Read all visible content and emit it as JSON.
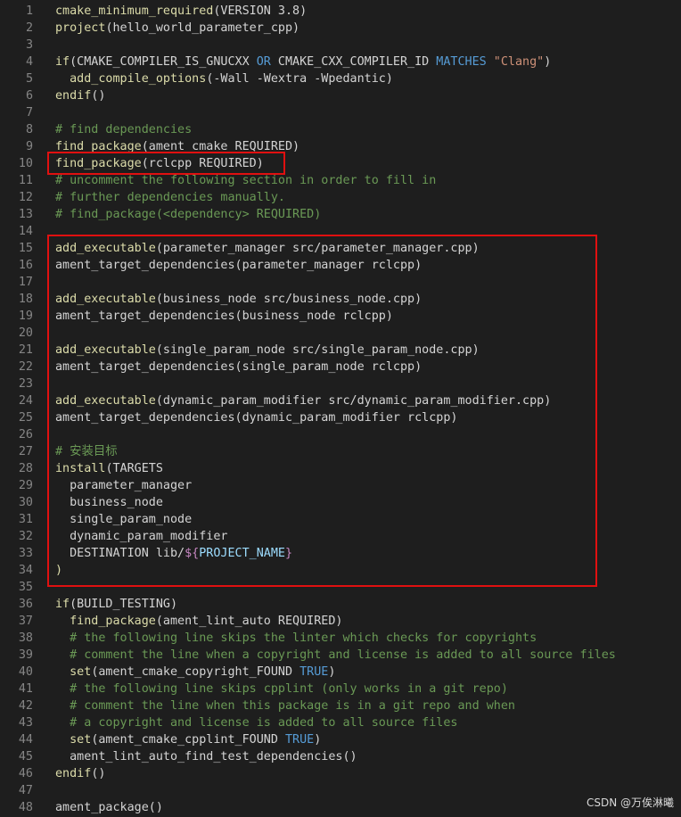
{
  "colors": {
    "background": "#1e1e1e",
    "line_number": "#858585",
    "function": "#dcdcaa",
    "keyword": "#c586c0",
    "constant": "#569cd6",
    "variable": "#9cdcfe",
    "string": "#ce9178",
    "comment": "#6a9955",
    "text": "#d4d4d4",
    "highlight_box": "#e01010"
  },
  "lines": [
    {
      "n": "1",
      "tokens": [
        [
          "fn",
          "cmake_minimum_required"
        ],
        [
          "txt",
          "(VERSION 3.8)"
        ]
      ]
    },
    {
      "n": "2",
      "tokens": [
        [
          "fn",
          "project"
        ],
        [
          "txt",
          "(hello_world_parameter_cpp)"
        ]
      ]
    },
    {
      "n": "3",
      "tokens": []
    },
    {
      "n": "4",
      "tokens": [
        [
          "fn",
          "if"
        ],
        [
          "txt",
          "(CMAKE_COMPILER_IS_GNUCXX "
        ],
        [
          "ctl",
          "OR"
        ],
        [
          "txt",
          " CMAKE_CXX_COMPILER_ID "
        ],
        [
          "ctl",
          "MATCHES"
        ],
        [
          "txt",
          " "
        ],
        [
          "str",
          "\"Clang\""
        ],
        [
          "txt",
          ")"
        ]
      ]
    },
    {
      "n": "5",
      "tokens": [
        [
          "txt",
          "  "
        ],
        [
          "fn",
          "add_compile_options"
        ],
        [
          "txt",
          "(-Wall -Wextra -Wpedantic)"
        ]
      ]
    },
    {
      "n": "6",
      "tokens": [
        [
          "fn",
          "endif"
        ],
        [
          "txt",
          "()"
        ]
      ]
    },
    {
      "n": "7",
      "tokens": []
    },
    {
      "n": "8",
      "tokens": [
        [
          "com",
          "# find dependencies"
        ]
      ]
    },
    {
      "n": "9",
      "tokens": [
        [
          "fn",
          "find_package"
        ],
        [
          "txt",
          "(ament_cmake REQUIRED)"
        ]
      ]
    },
    {
      "n": "10",
      "tokens": [
        [
          "fn",
          "find_package"
        ],
        [
          "txt",
          "(rclcpp REQUIRED)"
        ]
      ]
    },
    {
      "n": "11",
      "tokens": [
        [
          "com",
          "# uncomment the following section in order to fill in"
        ]
      ]
    },
    {
      "n": "12",
      "tokens": [
        [
          "com",
          "# further dependencies manually."
        ]
      ]
    },
    {
      "n": "13",
      "tokens": [
        [
          "com",
          "# find_package(<dependency> REQUIRED)"
        ]
      ]
    },
    {
      "n": "14",
      "tokens": []
    },
    {
      "n": "15",
      "tokens": [
        [
          "fn",
          "add_executable"
        ],
        [
          "txt",
          "(parameter_manager src/parameter_manager.cpp)"
        ]
      ]
    },
    {
      "n": "16",
      "tokens": [
        [
          "txt",
          "ament_target_dependencies(parameter_manager rclcpp)"
        ]
      ]
    },
    {
      "n": "17",
      "tokens": []
    },
    {
      "n": "18",
      "tokens": [
        [
          "fn",
          "add_executable"
        ],
        [
          "txt",
          "(business_node src/business_node.cpp)"
        ]
      ]
    },
    {
      "n": "19",
      "tokens": [
        [
          "txt",
          "ament_target_dependencies(business_node rclcpp)"
        ]
      ]
    },
    {
      "n": "20",
      "tokens": []
    },
    {
      "n": "21",
      "tokens": [
        [
          "fn",
          "add_executable"
        ],
        [
          "txt",
          "(single_param_node src/single_param_node.cpp)"
        ]
      ]
    },
    {
      "n": "22",
      "tokens": [
        [
          "txt",
          "ament_target_dependencies(single_param_node rclcpp)"
        ]
      ]
    },
    {
      "n": "23",
      "tokens": []
    },
    {
      "n": "24",
      "tokens": [
        [
          "fn",
          "add_executable"
        ],
        [
          "txt",
          "(dynamic_param_modifier src/dynamic_param_modifier.cpp)"
        ]
      ]
    },
    {
      "n": "25",
      "tokens": [
        [
          "txt",
          "ament_target_dependencies(dynamic_param_modifier rclcpp)"
        ]
      ]
    },
    {
      "n": "26",
      "tokens": []
    },
    {
      "n": "27",
      "tokens": [
        [
          "com",
          "# 安装目标"
        ]
      ]
    },
    {
      "n": "28",
      "tokens": [
        [
          "fn",
          "install"
        ],
        [
          "txt",
          "(TARGETS"
        ]
      ]
    },
    {
      "n": "29",
      "tokens": [
        [
          "txt",
          "  parameter_manager"
        ]
      ]
    },
    {
      "n": "30",
      "tokens": [
        [
          "txt",
          "  business_node"
        ]
      ]
    },
    {
      "n": "31",
      "tokens": [
        [
          "txt",
          "  single_param_node"
        ]
      ]
    },
    {
      "n": "32",
      "tokens": [
        [
          "txt",
          "  dynamic_param_modifier"
        ]
      ]
    },
    {
      "n": "33",
      "tokens": [
        [
          "txt",
          "  DESTINATION lib/"
        ],
        [
          "kw",
          "${"
        ],
        [
          "var",
          "PROJECT_NAME"
        ],
        [
          "kw",
          "}"
        ]
      ]
    },
    {
      "n": "34",
      "tokens": [
        [
          "fn",
          ")"
        ]
      ]
    },
    {
      "n": "35",
      "tokens": []
    },
    {
      "n": "36",
      "tokens": [
        [
          "fn",
          "if"
        ],
        [
          "txt",
          "(BUILD_TESTING)"
        ]
      ]
    },
    {
      "n": "37",
      "tokens": [
        [
          "txt",
          "  "
        ],
        [
          "fn",
          "find_package"
        ],
        [
          "txt",
          "(ament_lint_auto REQUIRED)"
        ]
      ]
    },
    {
      "n": "38",
      "tokens": [
        [
          "txt",
          "  "
        ],
        [
          "com",
          "# the following line skips the linter which checks for copyrights"
        ]
      ]
    },
    {
      "n": "39",
      "tokens": [
        [
          "txt",
          "  "
        ],
        [
          "com",
          "# comment the line when a copyright and license is added to all source files"
        ]
      ]
    },
    {
      "n": "40",
      "tokens": [
        [
          "txt",
          "  "
        ],
        [
          "fn",
          "set"
        ],
        [
          "txt",
          "(ament_cmake_copyright_FOUND "
        ],
        [
          "ctl",
          "TRUE"
        ],
        [
          "txt",
          ")"
        ]
      ]
    },
    {
      "n": "41",
      "tokens": [
        [
          "txt",
          "  "
        ],
        [
          "com",
          "# the following line skips cpplint (only works in a git repo)"
        ]
      ]
    },
    {
      "n": "42",
      "tokens": [
        [
          "txt",
          "  "
        ],
        [
          "com",
          "# comment the line when this package is in a git repo and when"
        ]
      ]
    },
    {
      "n": "43",
      "tokens": [
        [
          "txt",
          "  "
        ],
        [
          "com",
          "# a copyright and license is added to all source files"
        ]
      ]
    },
    {
      "n": "44",
      "tokens": [
        [
          "txt",
          "  "
        ],
        [
          "fn",
          "set"
        ],
        [
          "txt",
          "(ament_cmake_cpplint_FOUND "
        ],
        [
          "ctl",
          "TRUE"
        ],
        [
          "txt",
          ")"
        ]
      ]
    },
    {
      "n": "45",
      "tokens": [
        [
          "txt",
          "  ament_lint_auto_find_test_dependencies()"
        ]
      ]
    },
    {
      "n": "46",
      "tokens": [
        [
          "fn",
          "endif"
        ],
        [
          "txt",
          "()"
        ]
      ]
    },
    {
      "n": "47",
      "tokens": []
    },
    {
      "n": "48",
      "tokens": [
        [
          "txt",
          "ament_package()"
        ]
      ]
    }
  ],
  "watermark": "CSDN @万俟淋曦"
}
